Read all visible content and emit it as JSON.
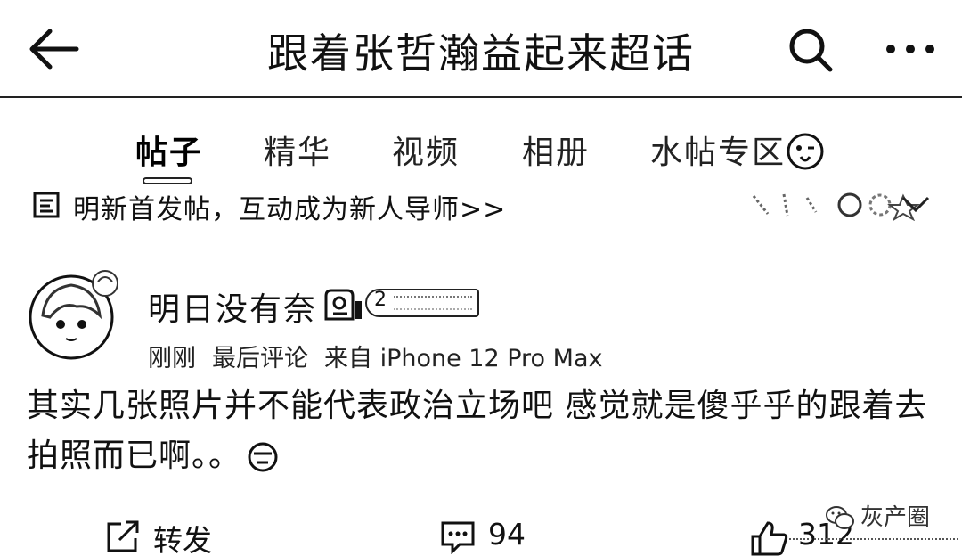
{
  "header": {
    "title": "跟着张哲瀚益起来超话"
  },
  "tabs": [
    {
      "label": "帖子",
      "active": true
    },
    {
      "label": "精华",
      "active": false
    },
    {
      "label": "视频",
      "active": false
    },
    {
      "label": "相册",
      "active": false
    },
    {
      "label": "水帖专区",
      "active": false
    }
  ],
  "notice": {
    "text": "明新首发帖，互动成为新人导师>>"
  },
  "post": {
    "username": "明日没有奈",
    "fan_level": "2",
    "meta": {
      "time": "刚刚",
      "activity": "最后评论",
      "source": "来自 iPhone 12 Pro Max"
    },
    "content": "其实几张照片并不能代表政治立场吧 感觉就是傻乎乎的跟着去拍照而已啊。。",
    "actions": {
      "repost": "转发",
      "comments": "94",
      "likes": "312"
    }
  },
  "watermark": {
    "text": "灰产圈"
  },
  "colors": {
    "background": "#ffffff",
    "text": "#111111",
    "line": "#222222"
  },
  "icons": [
    "back-arrow-icon",
    "search-icon",
    "more-dots-icon",
    "wink-emoji-icon",
    "notice-icon",
    "chevron-down-icon",
    "level-badge-icon",
    "emoji-icon",
    "repost-icon",
    "comment-icon",
    "like-icon",
    "wechat-icon"
  ]
}
